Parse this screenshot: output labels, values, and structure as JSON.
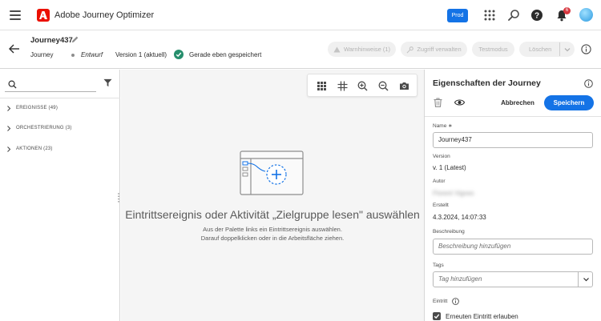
{
  "app": {
    "title": "Adobe Journey Optimizer",
    "sandbox_badge": "Prod",
    "notification_count": "6"
  },
  "journey": {
    "name": "Journey437",
    "type": "Journey",
    "status": "Entwurf",
    "version": "Version 1 (aktuell)",
    "saved_status": "Gerade eben gespeichert"
  },
  "header_actions": {
    "warnings_label": "Warnhinweise (1)",
    "access_label": "Zugriff verwalten",
    "test_mode_label": "Testmodus",
    "delete_label": "Löschen"
  },
  "palette": {
    "search_placeholder": "",
    "sections": [
      {
        "label": "EREIGNISSE (49)"
      },
      {
        "label": "ORCHESTRIERUNG (3)"
      },
      {
        "label": "AKTIONEN (23)"
      }
    ]
  },
  "canvas": {
    "empty_title": "Eintrittsereignis oder Aktivität „Zielgruppe lesen\" auswählen",
    "empty_line1": "Aus der Palette links ein Eintrittsereignis auswählen.",
    "empty_line2": "Darauf doppelklicken oder in die Arbeitsfläche ziehen."
  },
  "properties": {
    "title": "Eigenschaften der Journey",
    "cancel_label": "Abbrechen",
    "save_label": "Speichern",
    "name_label": "Name ∗",
    "name_value": "Journey437",
    "version_label": "Version",
    "version_value": "v. 1 (Latest)",
    "author_label": "Autor",
    "author_value": "Florent Vignes",
    "created_label": "Erstellt",
    "created_value": "4.3.2024, 14:07:33",
    "description_label": "Beschreibung",
    "description_placeholder": "Beschreibung hinzufügen",
    "tags_label": "Tags",
    "tags_placeholder": "Tag hinzufügen",
    "entry_label": "Eintritt",
    "reentry_label": "Erneuten Eintritt erlauben",
    "reentry_checked": true
  },
  "colors": {
    "accent": "#1473e6",
    "adobe_red": "#eb1000",
    "success": "#268e6c"
  }
}
